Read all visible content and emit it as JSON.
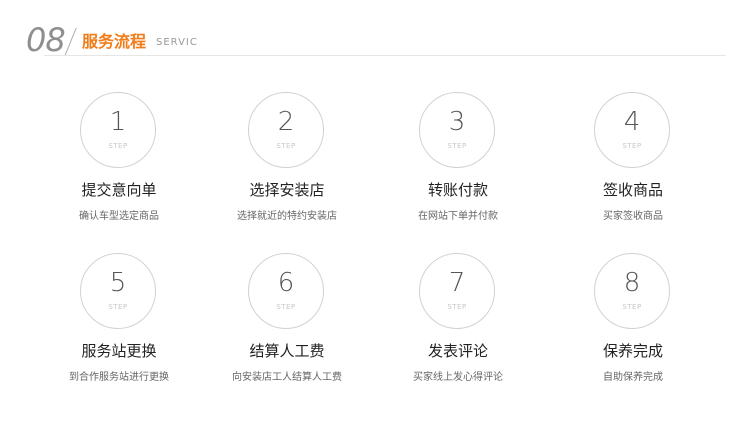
{
  "header": {
    "number": "08",
    "title": "服务流程",
    "subtitle": "SERVIC"
  },
  "steps": [
    {
      "num": "1",
      "label": "STEP",
      "title": "提交意向单",
      "desc": "确认车型选定商品"
    },
    {
      "num": "2",
      "label": "STEP",
      "title": "选择安装店",
      "desc": "选择就近的特约安装店"
    },
    {
      "num": "3",
      "label": "STEP",
      "title": "转账付款",
      "desc": "在网站下单并付款"
    },
    {
      "num": "4",
      "label": "STEP",
      "title": "签收商品",
      "desc": "买家签收商品"
    },
    {
      "num": "5",
      "label": "STEP",
      "title": "服务站更换",
      "desc": "到合作服务站进行更换"
    },
    {
      "num": "6",
      "label": "STEP",
      "title": "结算人工费",
      "desc": "向安装店工人结算人工费"
    },
    {
      "num": "7",
      "label": "STEP",
      "title": "发表评论",
      "desc": "买家线上发心得评论"
    },
    {
      "num": "8",
      "label": "STEP",
      "title": "保养完成",
      "desc": "自助保养完成"
    }
  ]
}
